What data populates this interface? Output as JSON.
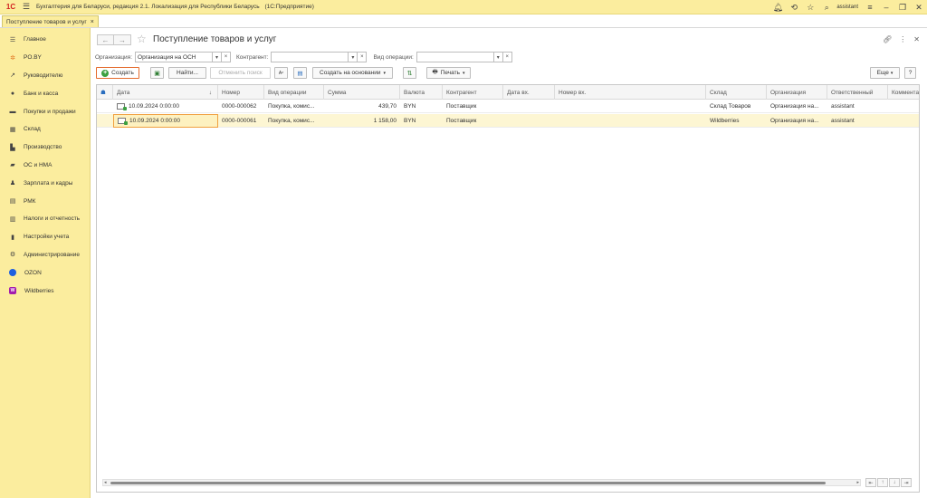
{
  "app": {
    "title": "Бухгалтерия для Беларуси, редакция 2.1. Локализация для Республики Беларусь",
    "platform": "(1С:Предприятие)",
    "logo": "1С",
    "user": "assistant"
  },
  "tab": {
    "label": "Поступление товаров и услуг"
  },
  "sidebar": {
    "items": [
      {
        "label": "Главное",
        "icon": "menu-icon"
      },
      {
        "label": "PO.BY",
        "icon": "sun-icon"
      },
      {
        "label": "Руководителю",
        "icon": "trend-icon"
      },
      {
        "label": "Банк и касса",
        "icon": "coin-icon"
      },
      {
        "label": "Покупки и продажи",
        "icon": "cart-icon"
      },
      {
        "label": "Склад",
        "icon": "warehouse-icon"
      },
      {
        "label": "Производство",
        "icon": "factory-icon"
      },
      {
        "label": "ОС и НМА",
        "icon": "truck-icon"
      },
      {
        "label": "Зарплата и кадры",
        "icon": "person-icon"
      },
      {
        "label": "РМК",
        "icon": "register-icon"
      },
      {
        "label": "Налоги и отчетность",
        "icon": "report-icon"
      },
      {
        "label": "Настройки учета",
        "icon": "settings-doc-icon"
      },
      {
        "label": "Администрирование",
        "icon": "gear-icon"
      },
      {
        "label": "OZON",
        "icon": "ozon-icon"
      },
      {
        "label": "Wildberries",
        "icon": "wildberries-icon"
      }
    ]
  },
  "page": {
    "title": "Поступление товаров и услуг"
  },
  "filters": {
    "org_label": "Организация:",
    "org_value": "Организация на ОСН",
    "contractor_label": "Контрагент:",
    "contractor_value": "",
    "operation_label": "Вид операции:",
    "operation_value": ""
  },
  "toolbar": {
    "create": "Создать",
    "find": "Найти...",
    "cancel_search": "Отменить поиск",
    "create_based": "Создать на основании",
    "print": "Печать",
    "more": "Еще"
  },
  "table": {
    "columns": [
      "Дата",
      "Номер",
      "Вид операции",
      "Сумма",
      "Валюта",
      "Контрагент",
      "Дата вх.",
      "Номер вх.",
      "Склад",
      "Организация",
      "Ответственный",
      "Коммента"
    ],
    "rows": [
      {
        "date": "10.09.2024 0:00:00",
        "number": "0000-000062",
        "operation": "Покупка, комис...",
        "sum": "439,70",
        "currency": "BYN",
        "contractor": "Поставщик",
        "in_date": "",
        "in_number": "",
        "warehouse": "Склад Товаров",
        "org": "Организация на...",
        "responsible": "assistant",
        "comment": ""
      },
      {
        "date": "10.09.2024 0:00:00",
        "number": "0000-000061",
        "operation": "Покупка, комис...",
        "sum": "1 158,00",
        "currency": "BYN",
        "contractor": "Поставщик",
        "in_date": "",
        "in_number": "",
        "warehouse": "Wildberries",
        "org": "Организация на...",
        "responsible": "assistant",
        "comment": ""
      }
    ]
  },
  "colors": {
    "accent": "#fbed9e",
    "create_border": "#e46b2d",
    "selected_row": "#fdf6d3"
  }
}
